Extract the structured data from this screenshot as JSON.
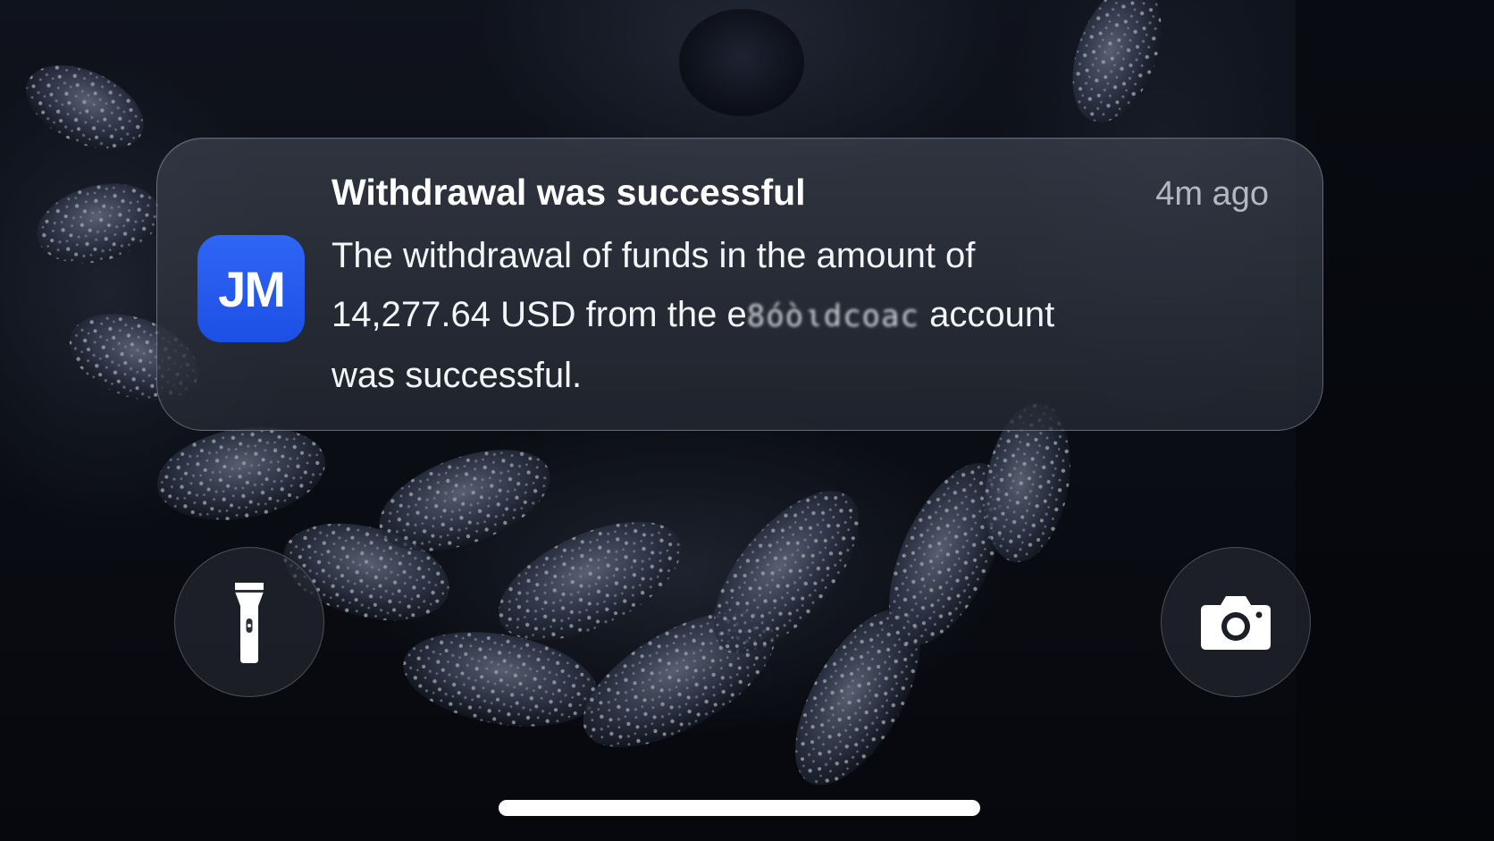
{
  "notification": {
    "app_icon_text": "JM",
    "title": "Withdrawal was successful",
    "time": "4m ago",
    "body_line1": "The withdrawal of funds in the amount of",
    "body_line2_start": "14,277.64 USD from the e",
    "body_line2_redacted": "8όòιdcoac",
    "body_line2_end": "account",
    "body_line3": "was successful."
  },
  "lockscreen": {
    "left_button_icon": "flashlight-icon",
    "right_button_icon": "camera-icon"
  },
  "colors": {
    "app_icon_blue": "#2457f0",
    "notification_bg": "#2e333e",
    "home_indicator": "#ffffff"
  }
}
